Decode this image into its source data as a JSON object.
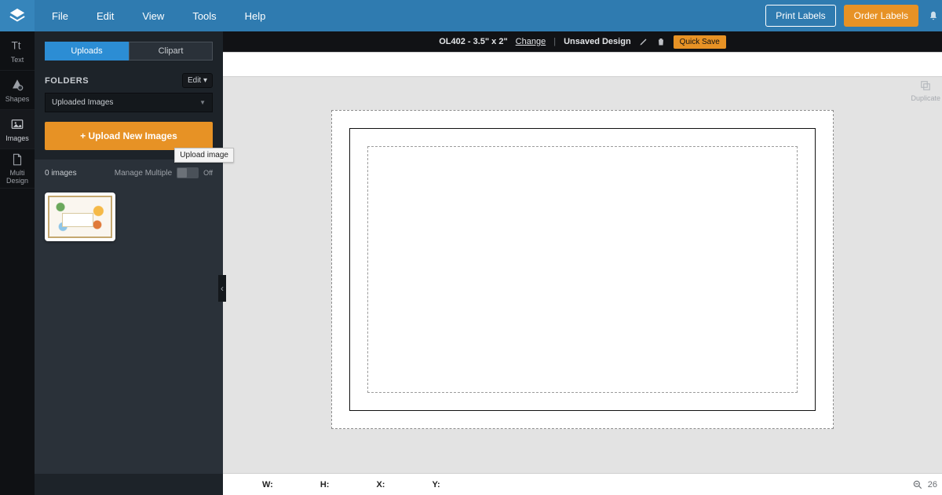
{
  "topbar": {
    "menus": [
      "File",
      "Edit",
      "View",
      "Tools",
      "Help"
    ],
    "print_label": "Print Labels",
    "order_label": "Order Labels"
  },
  "toolstrip": {
    "text": "Text",
    "shapes": "Shapes",
    "images": "Images",
    "multi": "Multi Design"
  },
  "panel": {
    "tab_uploads": "Uploads",
    "tab_clipart": "Clipart",
    "folders_label": "FOLDERS",
    "edit_label": "Edit ▾",
    "selected_folder": "Uploaded Images",
    "upload_btn": "+ Upload New Images",
    "tooltip": "Upload image",
    "image_count": "0 images",
    "manage_label": "Manage Multiple",
    "toggle_off": "Off"
  },
  "infobar": {
    "product": "OL402 - 3.5\" x 2\"",
    "change": "Change",
    "unsaved": "Unsaved Design",
    "quicksave": "Quick Save"
  },
  "right_tools": {
    "duplicate": "Duplicate"
  },
  "bottom": {
    "w": "W:",
    "h": "H:",
    "x": "X:",
    "y": "Y:",
    "zoom": "26"
  }
}
